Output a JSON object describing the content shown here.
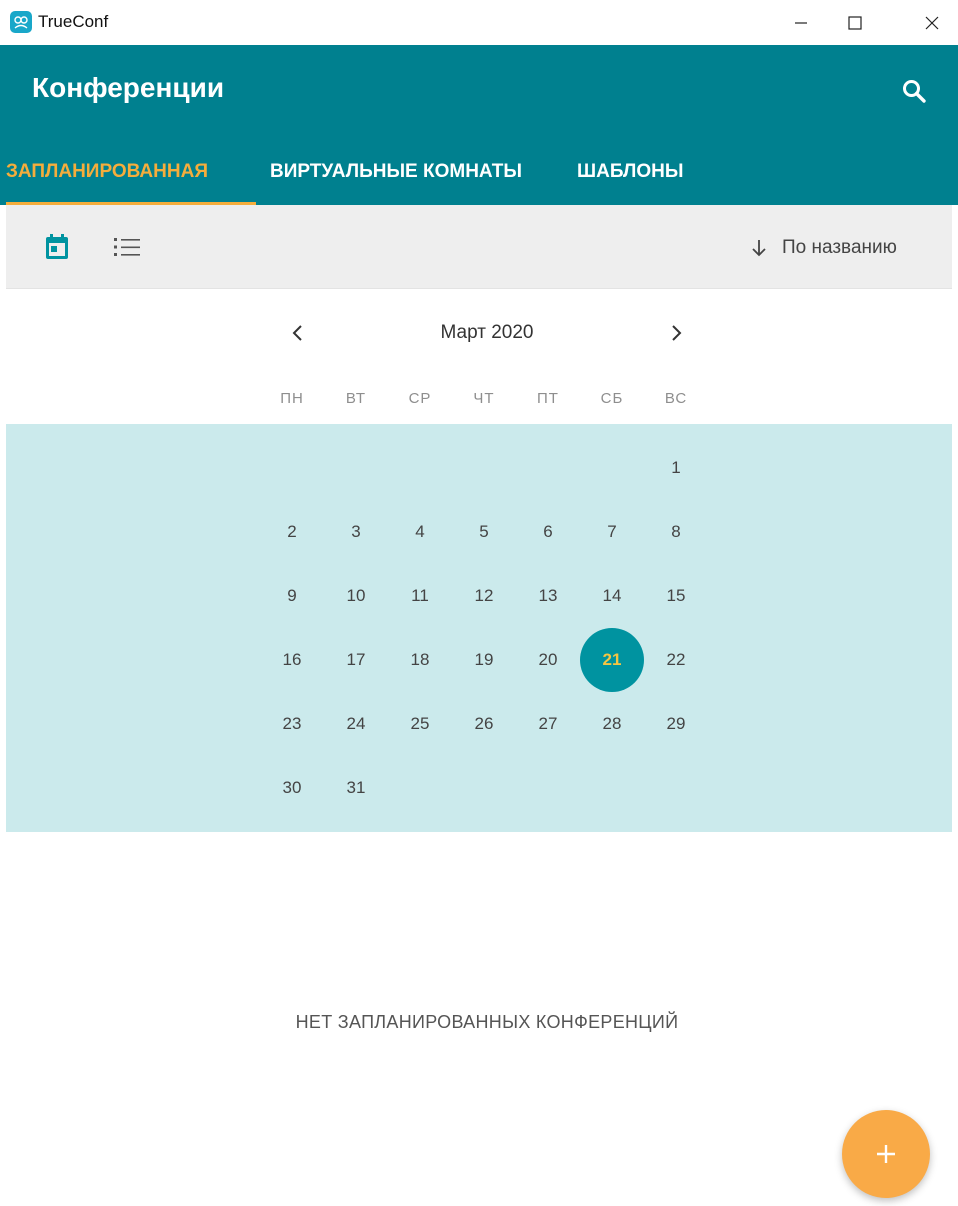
{
  "window": {
    "title": "TrueConf",
    "logo_icon": "trueconf-logo-icon",
    "controls": [
      "minimize-icon",
      "maximize-icon",
      "close-icon"
    ]
  },
  "header": {
    "title": "Конференции",
    "search_icon": "search-icon",
    "background": "#00808f"
  },
  "tabs": [
    {
      "label": "ЗАПЛАНИРОВАННАЯ",
      "active": true
    },
    {
      "label": "ВИРТУАЛЬНЫЕ КОМНАТЫ",
      "active": false
    },
    {
      "label": "ШАБЛОНЫ",
      "active": false
    }
  ],
  "accent": "#f5ad3c",
  "toolbar": {
    "view_calendar_icon": "calendar-icon",
    "view_list_icon": "list-icon",
    "sort_icon": "arrow-down-icon",
    "sort_label": "По названию"
  },
  "calendar": {
    "month_label": "Март 2020",
    "weekdays": [
      "ПН",
      "ВТ",
      "СР",
      "ЧТ",
      "ПТ",
      "СБ",
      "ВС"
    ],
    "first_weekday_index": 6,
    "days_in_month": 31,
    "selected_day": 21
  },
  "empty_message": "НЕТ ЗАПЛАНИРОВАННЫХ КОНФЕРЕНЦИЙ",
  "fab": {
    "icon": "plus-icon",
    "color": "#f9aa47"
  }
}
